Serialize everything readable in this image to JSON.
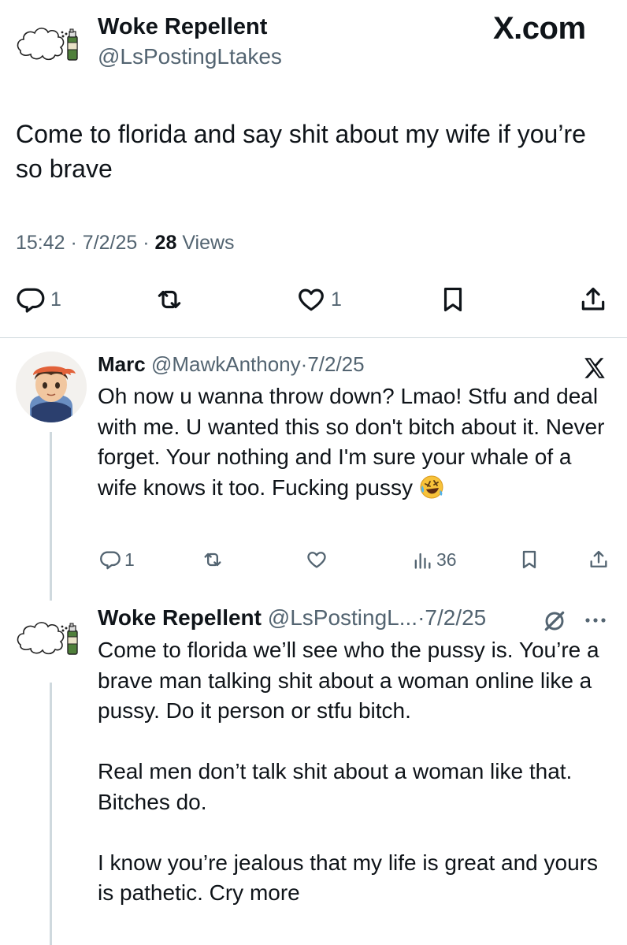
{
  "brand": {
    "label": "X.com"
  },
  "main_tweet": {
    "author": {
      "name": "Woke Repellent",
      "handle": "@LsPostingLtakes"
    },
    "text": "Come to florida and say shit about my wife if you’re so brave",
    "time": "15:42",
    "date": "7/2/25",
    "views_count": "28",
    "views_label": "Views",
    "separator": "·",
    "actions": {
      "replies": "1",
      "reposts": "",
      "likes": "1"
    }
  },
  "reply1": {
    "author": {
      "name": "Marc",
      "handle": "@MawkAnthony"
    },
    "separator": "·",
    "date": "7/2/25",
    "text": "Oh now u wanna throw down? Lmao! Stfu and deal with me. U wanted this so don't bitch about it. Never forget. Your nothing and I'm sure your whale of a wife knows it too. Fucking pussy",
    "emoji": "rolling-on-floor-laughing",
    "actions": {
      "replies": "1",
      "views": "36"
    }
  },
  "reply2": {
    "author": {
      "name": "Woke Repellent",
      "handle": "@LsPostingL..."
    },
    "separator": "·",
    "date": "7/2/25",
    "paragraphs": [
      "Come to florida we’ll see who the pussy is. You’re a brave man talking shit about a woman online like a pussy. Do it person or stfu bitch.",
      "Real men don’t talk shit about a woman like that. Bitches do.",
      "I know you’re jealous that my life is great and yours is pathetic. Cry more"
    ]
  },
  "colors": {
    "text": "#0f1419",
    "secondary": "#536471",
    "divider": "#cfd9de"
  },
  "icons": [
    "reply-icon",
    "repost-icon",
    "like-icon",
    "bookmark-icon",
    "share-icon",
    "views-icon",
    "x-logo-icon",
    "grok-icon",
    "more-icon"
  ]
}
